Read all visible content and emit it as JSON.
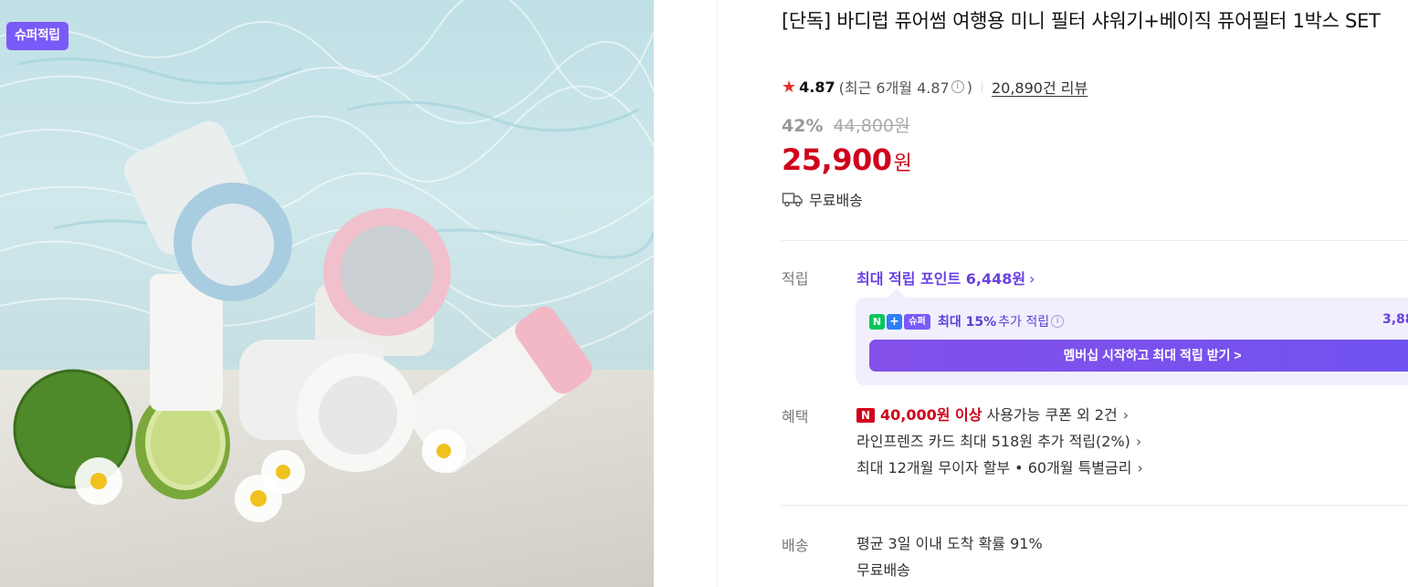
{
  "image": {
    "badge": "슈퍼적립",
    "alt": "product-photo"
  },
  "product": {
    "title": "[단독] 바디럽 퓨어썸 여행용 미니 필터 샤워기+베이직 퓨어필터 1박스 SET",
    "rating": {
      "score": "4.87",
      "recent": "(최근 6개월 4.87",
      "recent_close": ")",
      "reviews": "20,890건 리뷰"
    },
    "discount_rate": "42%",
    "original_price": "44,800원",
    "price": "25,900",
    "price_unit": "원",
    "shipping": "무료배송"
  },
  "points": {
    "label": "적립",
    "link": "최대 적립 포인트 6,448원",
    "promo": {
      "chip_n": "N",
      "chip_plus": "+",
      "chip_super": "슈퍼",
      "bold": "최대 15%",
      "text": "추가 적립",
      "amount": "3,88",
      "button": "멤버십 시작하고 최대 적립 받기 >"
    }
  },
  "benefits": {
    "label": "혜택",
    "coupon_badge": "N",
    "coupon_strong": "40,000원 이상",
    "coupon_text": "사용가능 쿠폰 외 2건",
    "card": "라인프렌즈 카드 최대 518원 추가 적립(2%)",
    "installment": "최대 12개월 무이자 할부 • 60개월 특별금리"
  },
  "delivery": {
    "label": "배송",
    "arrival": "평균 3일 이내 도착 확률 91%",
    "fee": "무료배송"
  },
  "colors": {
    "price_red": "#d0021b",
    "accent_purple": "#6941e6",
    "badge_purple": "#7a5af8",
    "naver_green": "#03c75a"
  }
}
